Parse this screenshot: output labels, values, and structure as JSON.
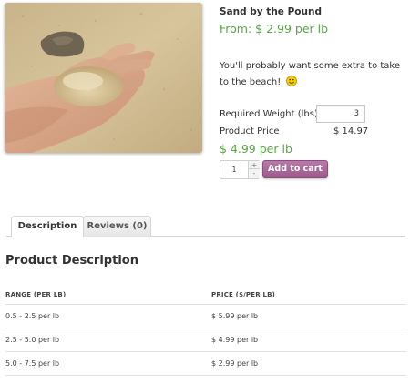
{
  "product": {
    "title": "Sand by the Pound",
    "price_from": "From: $ 2.99 per lb",
    "short_description": "You'll probably want some extra to take to the beach!",
    "required_weight_label": "Required Weight (lbs)",
    "required_weight_value": "3",
    "product_price_label": "Product Price",
    "product_price_value": "$ 14.97",
    "price_total": "$ 4.99 per lb",
    "quantity": "1",
    "qty_plus": "+",
    "qty_minus": "-",
    "add_to_cart_label": "Add to cart"
  },
  "tabs": [
    {
      "label": "Description",
      "active": true
    },
    {
      "label": "Reviews (0)",
      "active": false
    }
  ],
  "description": {
    "title": "Product Description",
    "table": {
      "headers": [
        "RANGE (PER LB)",
        "PRICE ($/PER LB)"
      ],
      "rows": [
        [
          "0.5 - 2.5 per lb",
          "$ 5.99 per lb"
        ],
        [
          "2.5 - 5.0 per lb",
          "$ 4.99 per lb"
        ],
        [
          "5.0 - 7.5 per lb",
          "$ 2.99 per lb"
        ]
      ]
    }
  },
  "colors": {
    "price_green": "#5aa547",
    "button_purple": "#9b5a8c",
    "tab_border": "#d6d6d6"
  },
  "icons": {
    "smiley": "smiley-emoticon-icon"
  }
}
